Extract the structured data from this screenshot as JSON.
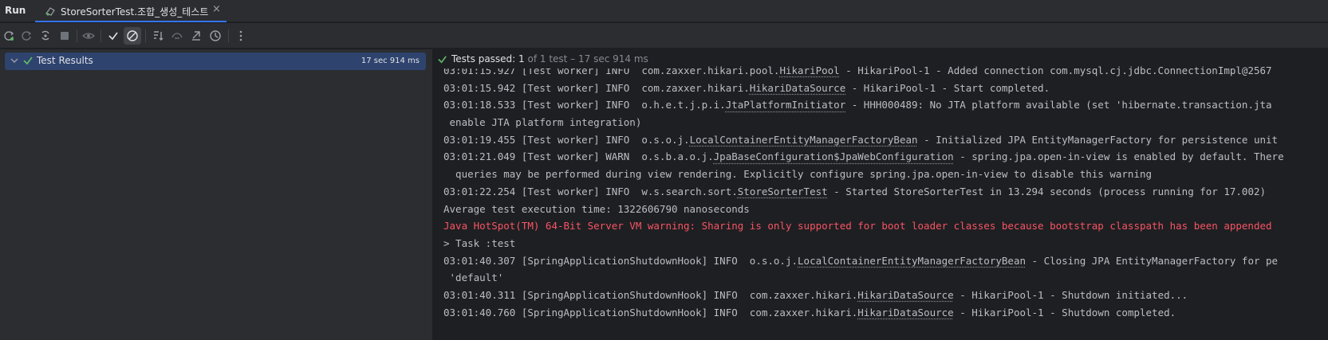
{
  "tabbar": {
    "run_label": "Run",
    "tab_label": "StoreSorterTest.조합_생성_테스트",
    "close_glyph": "×"
  },
  "toolbar": {
    "icons": [
      "rerun-icon",
      "rerun-failed-icon",
      "toggle-auto-test-icon",
      "stop-icon",
      "eye-icon",
      "show-passed-icon",
      "show-ignored-icon",
      "sort-icon",
      "import-icon",
      "export-icon",
      "history-icon",
      "more-icon"
    ]
  },
  "tree": {
    "label": "Test Results",
    "duration": "17 sec 914 ms"
  },
  "status": {
    "passed": "Tests passed: 1",
    "of": " of 1 test – 17 sec 914 ms"
  },
  "console": {
    "lines": [
      {
        "pre": "03:01:15.927 [Test worker] INFO  com.zaxxer.hikari.pool.",
        "link": "HikariPool",
        "post": " - HikariPool-1 - Added connection com.mysql.cj.jdbc.ConnectionImpl@2567",
        "type": "normal"
      },
      {
        "pre": "03:01:15.942 [Test worker] INFO  com.zaxxer.hikari.",
        "link": "HikariDataSource",
        "post": " - HikariPool-1 - Start completed.",
        "type": "normal"
      },
      {
        "pre": "03:01:18.533 [Test worker] INFO  o.h.e.t.j.p.i.",
        "link": "JtaPlatformInitiator",
        "post": " - HHH000489: No JTA platform available (set 'hibernate.transaction.jta",
        "type": "normal"
      },
      {
        "pre": " enable JTA platform integration)",
        "link": "",
        "post": "",
        "type": "normal"
      },
      {
        "pre": "03:01:19.455 [Test worker] INFO  o.s.o.j.",
        "link": "LocalContainerEntityManagerFactoryBean",
        "post": " - Initialized JPA EntityManagerFactory for persistence unit",
        "type": "normal"
      },
      {
        "pre": "03:01:21.049 [Test worker] WARN  o.s.b.a.o.j.",
        "link": "JpaBaseConfiguration$JpaWebConfiguration",
        "post": " - spring.jpa.open-in-view is enabled by default. There",
        "type": "normal"
      },
      {
        "pre": "  queries may be performed during view rendering. Explicitly configure spring.jpa.open-in-view to disable this warning",
        "link": "",
        "post": "",
        "type": "normal"
      },
      {
        "pre": "03:01:22.254 [Test worker] INFO  w.s.search.sort.",
        "link": "StoreSorterTest",
        "post": " - Started StoreSorterTest in 13.294 seconds (process running for 17.002)",
        "type": "normal"
      },
      {
        "pre": "Average test execution time: 1322606790 nanoseconds",
        "link": "",
        "post": "",
        "type": "normal"
      },
      {
        "pre": "Java HotSpot(TM) 64-Bit Server VM warning: Sharing is only supported for boot loader classes because bootstrap classpath has been appended",
        "link": "",
        "post": "",
        "type": "err"
      },
      {
        "pre": "> Task :test",
        "link": "",
        "post": "",
        "type": "normal"
      },
      {
        "pre": "03:01:40.307 [SpringApplicationShutdownHook] INFO  o.s.o.j.",
        "link": "LocalContainerEntityManagerFactoryBean",
        "post": " - Closing JPA EntityManagerFactory for pe",
        "type": "normal"
      },
      {
        "pre": " 'default'",
        "link": "",
        "post": "",
        "type": "normal"
      },
      {
        "pre": "03:01:40.311 [SpringApplicationShutdownHook] INFO  com.zaxxer.hikari.",
        "link": "HikariDataSource",
        "post": " - HikariPool-1 - Shutdown initiated...",
        "type": "normal"
      },
      {
        "pre": "03:01:40.760 [SpringApplicationShutdownHook] INFO  com.zaxxer.hikari.",
        "link": "HikariDataSource",
        "post": " - HikariPool-1 - Shutdown completed.",
        "type": "normal"
      }
    ]
  },
  "colors": {
    "accent": "#3574f0",
    "success": "#5fb865",
    "error": "#f75464",
    "selection": "#2e436e"
  }
}
